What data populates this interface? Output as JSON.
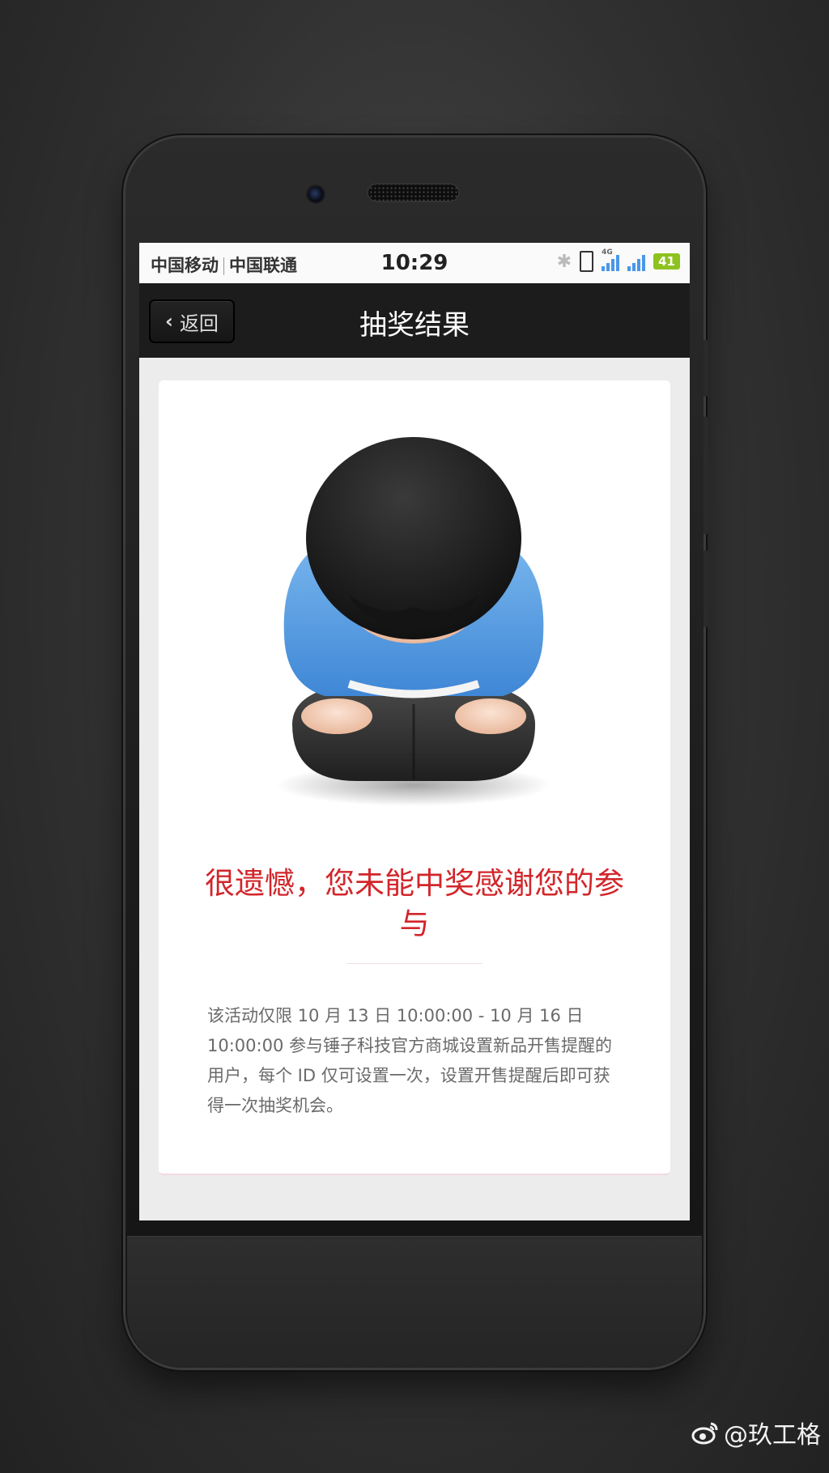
{
  "status_bar": {
    "carrier_1": "中国移动",
    "carrier_2": "中国联通",
    "time": "10:29",
    "signal_1_label": "4G",
    "battery": "41",
    "battery_color": "#8dc21f",
    "signal_color": "#4a97e8"
  },
  "nav": {
    "back_label": "返回",
    "title": "抽奖结果"
  },
  "card": {
    "illustration": "bowing-person-icon",
    "result_text": "很遗憾，您未能中奖感谢您的参与",
    "result_color": "#d2262b",
    "description": "该活动仅限 10 月 13 日 10:00:00 - 10 月 16 日 10:00:00 参与锤子科技官方商城设置新品开售提醒的用户，每个 ID 仅可设置一次，设置开售提醒后即可获得一次抽奖机会。"
  },
  "watermark": {
    "text": "@玖工格",
    "icon": "weibo-icon"
  }
}
